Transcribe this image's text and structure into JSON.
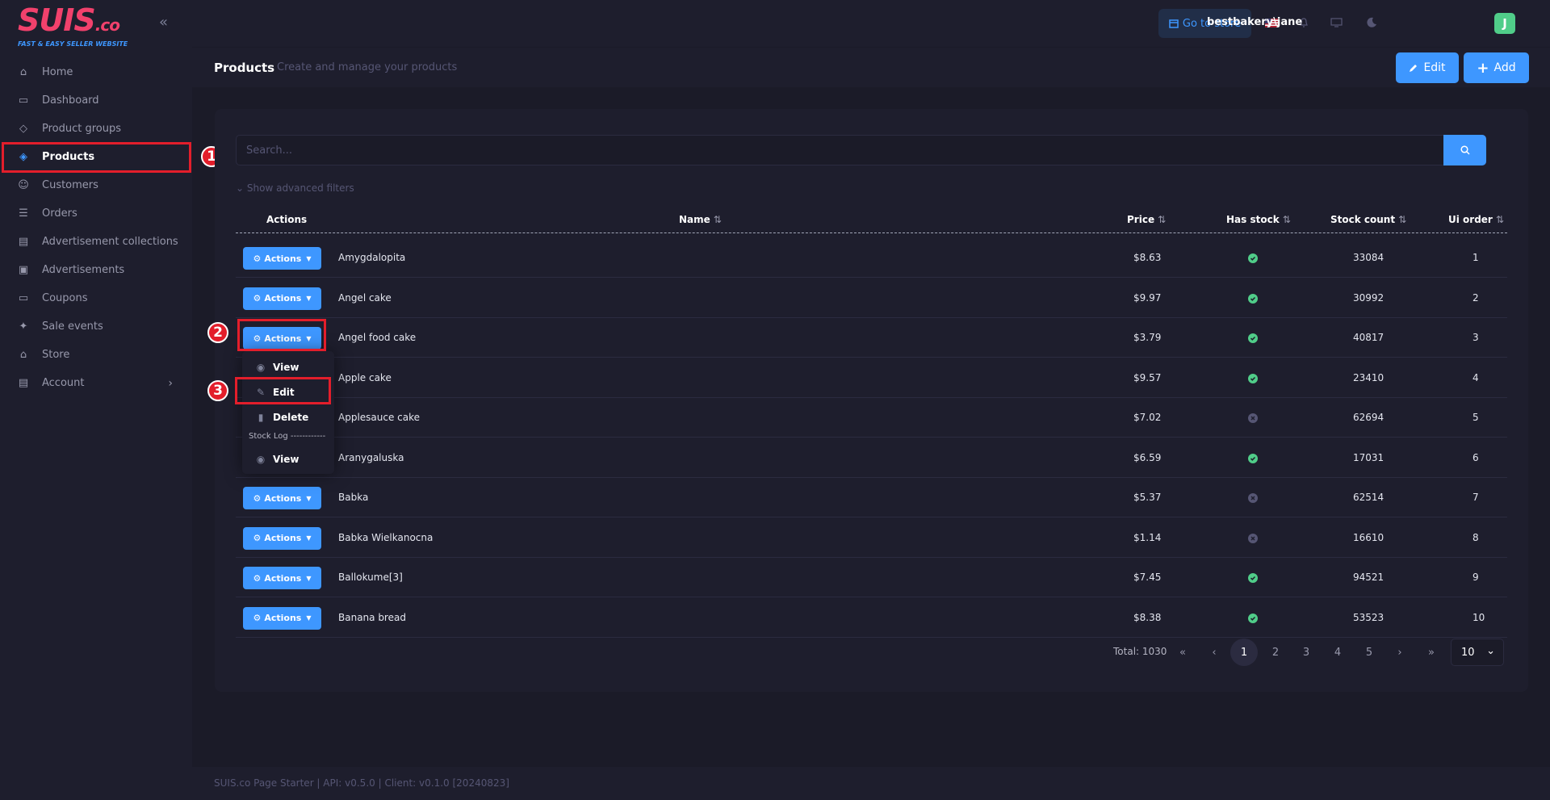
{
  "brand": {
    "logo": "SUIS",
    "logo_suffix": ".co",
    "tagline": "FAST & EASY SELLER WEBSITE"
  },
  "sidebar": {
    "items": [
      {
        "label": "Home",
        "icon": "home-icon"
      },
      {
        "label": "Dashboard",
        "icon": "dashboard-icon"
      },
      {
        "label": "Product groups",
        "icon": "product-groups-icon"
      },
      {
        "label": "Products",
        "icon": "products-icon",
        "active": true
      },
      {
        "label": "Customers",
        "icon": "customers-icon"
      },
      {
        "label": "Orders",
        "icon": "orders-icon"
      },
      {
        "label": "Advertisement collections",
        "icon": "ad-collections-icon"
      },
      {
        "label": "Advertisements",
        "icon": "advertisements-icon"
      },
      {
        "label": "Coupons",
        "icon": "coupons-icon"
      },
      {
        "label": "Sale events",
        "icon": "sale-events-icon"
      },
      {
        "label": "Store",
        "icon": "store-icon"
      },
      {
        "label": "Account",
        "icon": "account-icon",
        "has_submenu": true
      }
    ]
  },
  "topbar": {
    "store_button": "Go to store",
    "user": "bestbakery\\jane",
    "avatar_letter": "J"
  },
  "toolbar": {
    "title": "Products",
    "subtitle": "Create and manage your products",
    "edit_label": "Edit",
    "add_label": "Add"
  },
  "search": {
    "placeholder": "Search...",
    "advanced_filters": "Show advanced filters"
  },
  "table": {
    "columns": [
      "Actions",
      "Name",
      "Price",
      "Has stock",
      "Stock count",
      "Ui order"
    ],
    "action_label": "Actions",
    "rows": [
      {
        "name": "Amygdalopita",
        "price": "$8.63",
        "has_stock": true,
        "stock_count": "33084",
        "ui_order": "1"
      },
      {
        "name": "Angel cake",
        "price": "$9.97",
        "has_stock": true,
        "stock_count": "30992",
        "ui_order": "2"
      },
      {
        "name": "Angel food cake",
        "price": "$3.79",
        "has_stock": true,
        "stock_count": "40817",
        "ui_order": "3"
      },
      {
        "name": "Apple cake",
        "price": "$9.57",
        "has_stock": true,
        "stock_count": "23410",
        "ui_order": "4"
      },
      {
        "name": "Applesauce cake",
        "price": "$7.02",
        "has_stock": false,
        "stock_count": "62694",
        "ui_order": "5"
      },
      {
        "name": "Aranygaluska",
        "price": "$6.59",
        "has_stock": true,
        "stock_count": "17031",
        "ui_order": "6"
      },
      {
        "name": "Babka",
        "price": "$5.37",
        "has_stock": false,
        "stock_count": "62514",
        "ui_order": "7"
      },
      {
        "name": "Babka Wielkanocna",
        "price": "$1.14",
        "has_stock": false,
        "stock_count": "16610",
        "ui_order": "8"
      },
      {
        "name": "Ballokume[3]",
        "price": "$7.45",
        "has_stock": true,
        "stock_count": "94521",
        "ui_order": "9"
      },
      {
        "name": "Banana bread",
        "price": "$8.38",
        "has_stock": true,
        "stock_count": "53523",
        "ui_order": "10"
      }
    ]
  },
  "dropdown": {
    "view": "View",
    "edit": "Edit",
    "delete": "Delete",
    "stock_log": "Stock Log ------------",
    "stock_view": "View"
  },
  "pagination": {
    "total": "Total: 1030",
    "pages": [
      "1",
      "2",
      "3",
      "4",
      "5"
    ],
    "current": "1",
    "page_size": "10"
  },
  "annotations": [
    "1",
    "2",
    "3"
  ],
  "footer": "SUIS.co Page Starter | API: v0.5.0 | Client: v0.1.0 [20240823]",
  "colors": {
    "accent": "#3e97ff",
    "highlight": "#e31e2b",
    "success": "#50cd89",
    "logo": "#f1416c"
  }
}
